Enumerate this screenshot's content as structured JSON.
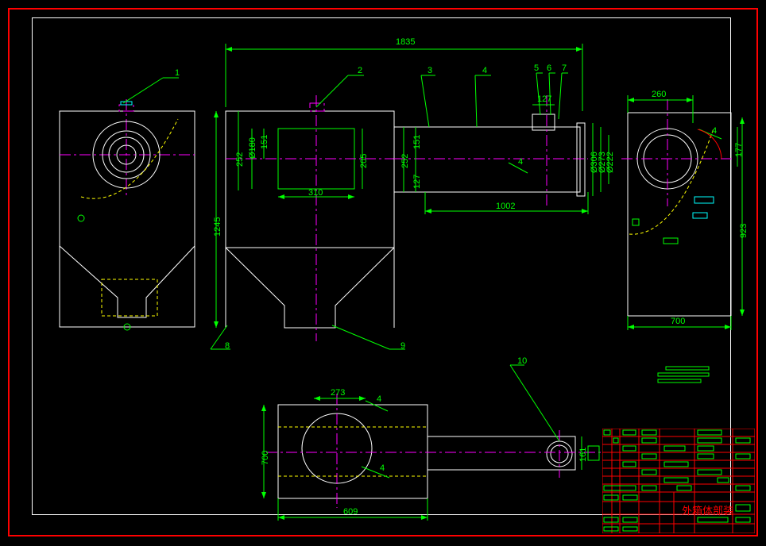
{
  "dims": {
    "top_span": "1835",
    "left_view": {
      "callout": "1"
    },
    "front_view": {
      "callouts": [
        "2",
        "8",
        "9"
      ],
      "d_top_w": "310",
      "d_252": "252",
      "d_151": "151",
      "d_205": "205",
      "d_1245": "1245",
      "d_dia180": "Ø180"
    },
    "side_arm": {
      "callouts": [
        "3",
        "4",
        "5",
        "6",
        "7"
      ],
      "d_252": "252",
      "d_151": "151",
      "d_127a": "127",
      "d_127b": "127",
      "d_1002": "1002",
      "d_4": "4",
      "d_phi222": "Ø222",
      "d_phi273": "Ø273",
      "d_phi306": "Ø306"
    },
    "right_view": {
      "d_260": "260",
      "d_700": "700",
      "d_923": "923",
      "d_177": "177",
      "d_4": "4"
    },
    "bottom_view": {
      "callout": "10",
      "d_273": "273",
      "d_4a": "4",
      "d_4b": "4",
      "d_609": "609",
      "d_700": "700",
      "d_161": "161"
    }
  },
  "title": "外箱体部装"
}
